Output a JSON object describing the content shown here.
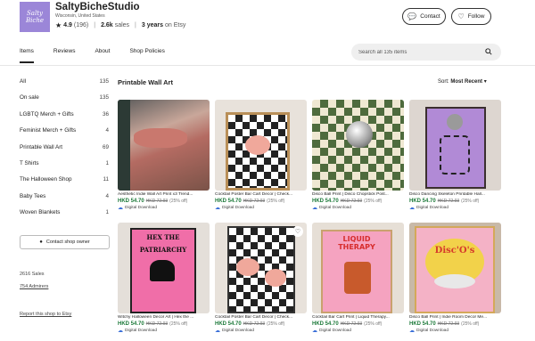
{
  "shop": {
    "logo_text": "Salty Biche",
    "name": "SaltyBicheStudio",
    "location": "Wisconsin, United States",
    "rating": "4.9",
    "reviews": "(196)",
    "sales": "2.6k",
    "sales_label": "sales",
    "years": "3 years",
    "years_label": "on Etsy"
  },
  "buttons": {
    "contact": "Contact",
    "follow": "Follow"
  },
  "tabs": [
    "Items",
    "Reviews",
    "About",
    "Shop Policies"
  ],
  "search": {
    "placeholder": "Search all 135 items"
  },
  "sidebar": {
    "items": [
      {
        "label": "All",
        "count": "135"
      },
      {
        "label": "On sale",
        "count": "135"
      },
      {
        "label": "LGBTQ Merch + Gifts",
        "count": "36"
      },
      {
        "label": "Feminist Merch + Gifts",
        "count": "4"
      },
      {
        "label": "Printable Wall Art",
        "count": "69"
      },
      {
        "label": "T Shirts",
        "count": "1"
      },
      {
        "label": "The Halloween Shop",
        "count": "11"
      },
      {
        "label": "Baby Tees",
        "count": "4"
      },
      {
        "label": "Woven Blankets",
        "count": "1"
      }
    ],
    "contact_owner": "Contact shop owner",
    "sales": "2616 Sales",
    "admirers": "754 Admirers",
    "report": "Report this shop to Etsy"
  },
  "listing": {
    "title": "Printable Wall Art",
    "sort_label": "Sort:",
    "sort_value": "Most Recent"
  },
  "products": [
    {
      "title": "Aesthetic Indie Wall Art Print x3 Trend...",
      "price": "HKD 54.70",
      "orig": "HKD 72.93",
      "disc": "(25% off)",
      "download": "Digital Download"
    },
    {
      "title": "Cocktail Poster Bar Cart Decor | Check...",
      "price": "HKD 54.70",
      "orig": "HKD 72.93",
      "disc": "(25% off)",
      "download": "Digital Download"
    },
    {
      "title": "Disco Ball Print | Disco Chopstick Post...",
      "price": "HKD 54.70",
      "orig": "HKD 72.93",
      "disc": "(25% off)",
      "download": "Digital Download"
    },
    {
      "title": "Disco Dancing Skeleton Printable Hall...",
      "price": "HKD 54.70",
      "orig": "HKD 72.93",
      "disc": "(25% off)",
      "download": "Digital Download"
    },
    {
      "title": "Witchy Halloween Decor Art | Hex the ...",
      "price": "HKD 54.70",
      "orig": "HKD 72.93",
      "disc": "(25% off)",
      "download": "Digital Download",
      "poster_text": "HEX THE PATRIARCHY"
    },
    {
      "title": "Cocktail Poster Bar Cart Decor | Check...",
      "price": "HKD 54.70",
      "orig": "HKD 72.93",
      "disc": "(25% off)",
      "download": "Digital Download"
    },
    {
      "title": "Cocktail Bar Cart Print | Liquid Therapy...",
      "price": "HKD 54.70",
      "orig": "HKD 72.93",
      "disc": "(25% off)",
      "download": "Digital Download",
      "poster_text": "LIQUID THERAPY"
    },
    {
      "title": "Disco Ball Print | Indie Room Decor Me...",
      "price": "HKD 54.70",
      "orig": "HKD 72.93",
      "disc": "(25% off)",
      "download": "Digital Download",
      "poster_text": "Disc'O's"
    }
  ],
  "colors": {
    "logo_bg": "#9b86d8",
    "price_green": "#1d7a3a"
  }
}
